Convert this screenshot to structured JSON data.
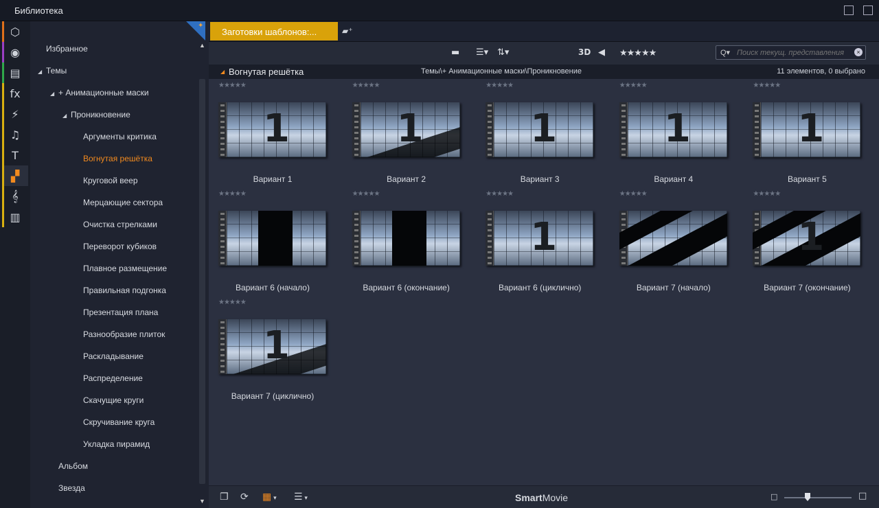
{
  "window": {
    "title": "Библиотека"
  },
  "iconbar": {
    "items": [
      {
        "name": "media-import-icon",
        "glyph": "⬡",
        "stripe": "#e0701a"
      },
      {
        "name": "film-reel-icon",
        "glyph": "◉",
        "stripe": "#9b3fc4"
      },
      {
        "name": "project-stack-icon",
        "glyph": "▤",
        "stripe": "#2fa84a"
      },
      {
        "name": "fx-icon",
        "glyph": "fx",
        "stripe": "#d9b010"
      },
      {
        "name": "lightning-icon",
        "glyph": "⚡",
        "stripe": "#d9b010"
      },
      {
        "name": "music-note-icon",
        "glyph": "♫",
        "stripe": "#d9b010"
      },
      {
        "name": "title-text-icon",
        "glyph": "T",
        "stripe": "#d9b010"
      },
      {
        "name": "montage-templates-icon",
        "glyph": "▞",
        "stripe": "#d9b010"
      },
      {
        "name": "treble-clef-icon",
        "glyph": "𝄞",
        "stripe": "#d9b010"
      },
      {
        "name": "piano-keys-icon",
        "glyph": "▥",
        "stripe": "#d9b010"
      }
    ]
  },
  "tree": {
    "items": [
      {
        "label": "Избранное",
        "indent": 0,
        "tri": ""
      },
      {
        "label": "Темы",
        "indent": 0,
        "tri": "◢"
      },
      {
        "label": "+ Анимационные маски",
        "indent": 1,
        "tri": "◢"
      },
      {
        "label": "Проникновение",
        "indent": 2,
        "tri": "◢"
      },
      {
        "label": "Аргументы критика",
        "indent": 3,
        "tri": ""
      },
      {
        "label": "Вогнутая решётка",
        "indent": 3,
        "tri": "",
        "active": true
      },
      {
        "label": "Круговой веер",
        "indent": 3,
        "tri": ""
      },
      {
        "label": "Мерцающие сектора",
        "indent": 3,
        "tri": ""
      },
      {
        "label": "Очистка стрелками",
        "indent": 3,
        "tri": ""
      },
      {
        "label": "Переворот кубиков",
        "indent": 3,
        "tri": ""
      },
      {
        "label": "Плавное размещение",
        "indent": 3,
        "tri": ""
      },
      {
        "label": "Правильная подгонка",
        "indent": 3,
        "tri": ""
      },
      {
        "label": "Презентация плана",
        "indent": 3,
        "tri": ""
      },
      {
        "label": "Разнообразие плиток",
        "indent": 3,
        "tri": ""
      },
      {
        "label": "Раскладывание",
        "indent": 3,
        "tri": ""
      },
      {
        "label": "Распределение",
        "indent": 3,
        "tri": ""
      },
      {
        "label": "Скачущие круги",
        "indent": 3,
        "tri": ""
      },
      {
        "label": "Скручивание круга",
        "indent": 3,
        "tri": ""
      },
      {
        "label": "Укладка пирамид",
        "indent": 3,
        "tri": ""
      },
      {
        "label": "Альбом",
        "indent": 1,
        "tri": ""
      },
      {
        "label": "Звезда",
        "indent": 1,
        "tri": ""
      }
    ]
  },
  "tab": {
    "label": "Заготовки шаблонов:..."
  },
  "toolbar": {
    "threed": "3D",
    "rating": "★★★★★",
    "search_placeholder": "Поиск текущ. представления"
  },
  "pathbar": {
    "name": "Вогнутая решётка",
    "path": "Темы\\+ Анимационные маски\\Проникновение",
    "count": "11 элементов, 0 выбрано"
  },
  "items": [
    {
      "label": "Вариант 1",
      "num": "1",
      "variant": "full"
    },
    {
      "label": "Вариант 2",
      "num": "1",
      "variant": "tilt"
    },
    {
      "label": "Вариант 3",
      "num": "1",
      "variant": "full"
    },
    {
      "label": "Вариант 4",
      "num": "1",
      "variant": "full"
    },
    {
      "label": "Вариант 5",
      "num": "1",
      "variant": "full"
    },
    {
      "label": "Вариант 6 (начало)",
      "num": "",
      "variant": "split"
    },
    {
      "label": "Вариант 6 (окончание)",
      "num": "",
      "variant": "split"
    },
    {
      "label": "Вариант 6 (циклично)",
      "num": "1",
      "variant": "full"
    },
    {
      "label": "Вариант 7 (начало)",
      "num": "",
      "variant": "diag"
    },
    {
      "label": "Вариант 7 (окончание)",
      "num": "1",
      "variant": "diag"
    },
    {
      "label": "Вариант 7 (циклично)",
      "num": "1",
      "variant": "tilt"
    }
  ],
  "footer": {
    "smart_bold": "Smart",
    "smart_rest": "Movie"
  }
}
